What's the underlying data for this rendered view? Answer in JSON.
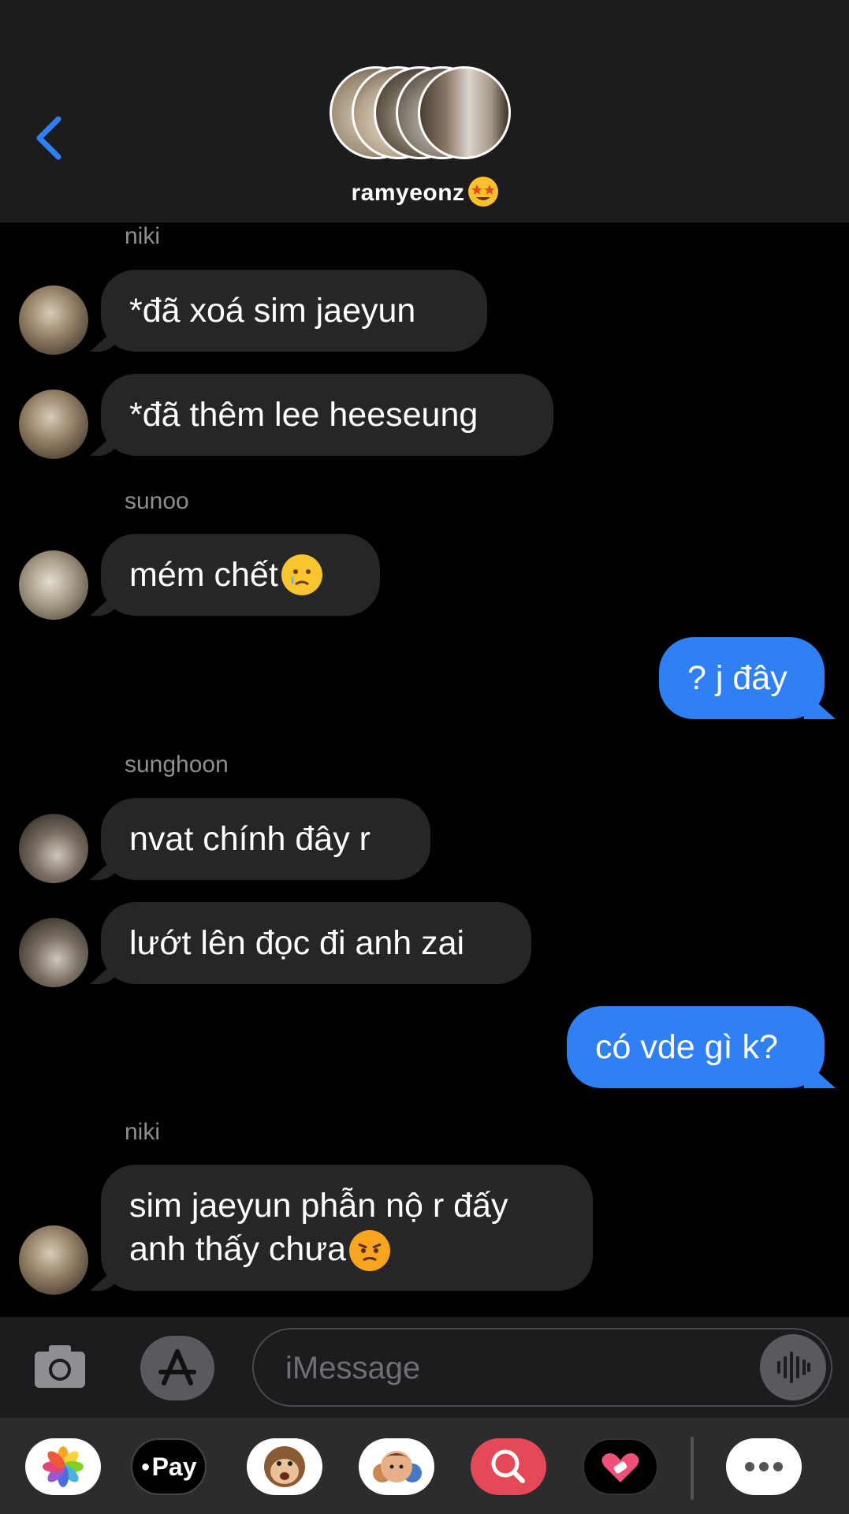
{
  "header": {
    "back_icon": "chevron-left-icon",
    "group_name": "ramyeonz",
    "group_emoji": "star-struck-emoji",
    "accent_color": "#2f7ff5"
  },
  "messages": [
    {
      "sender": "niki",
      "text": "*đã xoá sim jaeyun",
      "direction": "incoming"
    },
    {
      "text": "*đã thêm lee heeseung",
      "direction": "incoming"
    },
    {
      "sender": "sunoo",
      "text": "mém chết",
      "emoji": "crying-face-emoji",
      "direction": "incoming"
    },
    {
      "text": "? j đây",
      "direction": "outgoing"
    },
    {
      "sender": "sunghoon",
      "text": "nvat chính đây r",
      "direction": "incoming"
    },
    {
      "text": "lướt lên đọc đi anh zai",
      "direction": "incoming"
    },
    {
      "text": "có vde gì k?",
      "direction": "outgoing"
    },
    {
      "sender": "niki",
      "line1": "sim jaeyun phẫn nộ r đấy",
      "line2": "anh thấy chưa",
      "emoji": "angry-face-emoji",
      "direction": "incoming"
    }
  ],
  "input": {
    "placeholder": "iMessage",
    "camera_icon": "camera-icon",
    "apps_icon": "app-store-icon",
    "audio_icon": "audio-waveform-icon"
  },
  "apps": [
    {
      "name": "photos-icon"
    },
    {
      "name": "apple-pay-icon",
      "label": "Pay"
    },
    {
      "name": "animoji-monkey-icon"
    },
    {
      "name": "memoji-icon"
    },
    {
      "name": "image-search-icon"
    },
    {
      "name": "digital-touch-icon"
    },
    {
      "name": "more-icon"
    }
  ]
}
